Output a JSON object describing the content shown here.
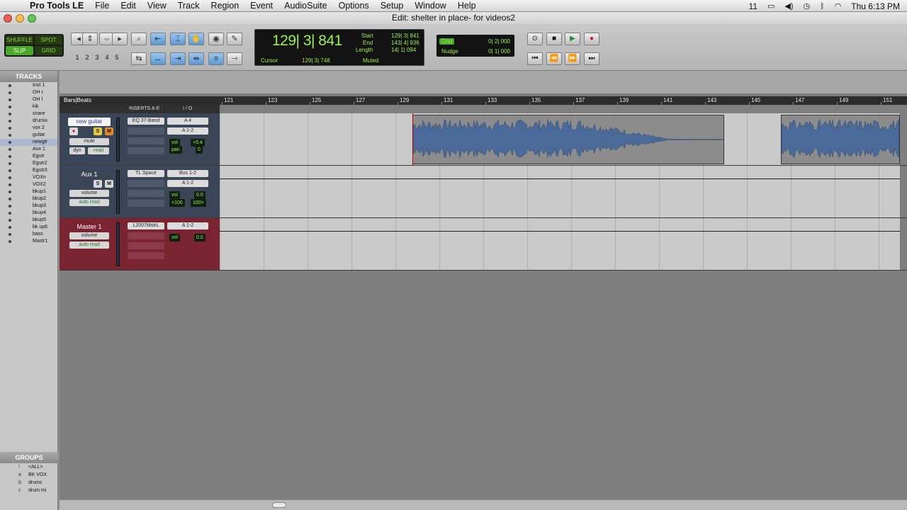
{
  "menubar": {
    "app": "Pro Tools LE",
    "items": [
      "File",
      "Edit",
      "View",
      "Track",
      "Region",
      "Event",
      "AudioSuite",
      "Options",
      "Setup",
      "Window",
      "Help"
    ],
    "status_number": "11",
    "clock": "Thu 6:13 PM"
  },
  "window": {
    "title": "Edit: shelter in place- for videos2"
  },
  "modes": {
    "shuffle": "SHUFFLE",
    "spot": "SPOT",
    "slip": "SLIP",
    "grid": "GRID"
  },
  "zoom_presets": [
    "1",
    "2",
    "3",
    "4",
    "5"
  ],
  "counter": {
    "main": "129| 3| 841",
    "start_label": "Start",
    "start": "129| 3| 841",
    "end_label": "End",
    "end": "143| 4| 936",
    "length_label": "Length",
    "length": "14| 1| 094",
    "cursor_label": "Cursor",
    "cursor": "129| 3| 748",
    "muted": "Muted"
  },
  "grid_nudge": {
    "grid_label": "Grid",
    "grid": "0| 2| 000",
    "nudge_label": "Nudge",
    "nudge": "0| 1| 000"
  },
  "tracks_panel": {
    "header": "TRACKS",
    "items": [
      "Inst 1",
      "OH r",
      "OH l",
      "kik",
      "snare",
      "drumix",
      "vox 2",
      "guitar",
      "newgtr",
      "Aux 1",
      "Egutr",
      "Egutr2",
      "Egutr3",
      "VOXn",
      "VOX2",
      "bkup1",
      "bkup2",
      "bkup3",
      "bkup4",
      "bkup5",
      "bk up6",
      "bass",
      "Mastr1"
    ]
  },
  "groups_panel": {
    "header": "GROUPS",
    "items": [
      {
        "letter": "!",
        "name": "<ALL>"
      },
      {
        "letter": "a",
        "name": "BK VOX"
      },
      {
        "letter": "b",
        "name": "drums"
      },
      {
        "letter": "c",
        "name": "drum mi"
      }
    ]
  },
  "ruler": {
    "label": "Bars|Beats",
    "ticks": [
      "121",
      "123",
      "125",
      "127",
      "129",
      "131",
      "133",
      "135",
      "137",
      "139",
      "141",
      "143",
      "145",
      "147",
      "149",
      "151"
    ]
  },
  "columns": {
    "inserts": "INSERTS A-E",
    "io": "I / O"
  },
  "tracks": [
    {
      "name": "new guitar",
      "insert": "EQ 37-Band",
      "output": "A 4",
      "input": "A 1-2",
      "automation": "dyn",
      "auto_mode": "read",
      "vol_label": "vol",
      "vol": "+5.4",
      "pan_label": "pan",
      "pan": "0",
      "view": "mute"
    },
    {
      "name": "Aux 1",
      "insert": "TL Space",
      "output": "Bus 1-2",
      "input": "A 1-2",
      "view": "volume",
      "auto_mode": "auto read",
      "vol_label": "vol",
      "vol": "0.0",
      "pan_l": "<100",
      "pan_r": "100>"
    },
    {
      "name": "Master 1",
      "insert": "L2007MstrL",
      "output": "A 1-2",
      "view": "volume",
      "auto_mode": "auto read",
      "vol_label": "vol",
      "vol": "0.0"
    }
  ]
}
